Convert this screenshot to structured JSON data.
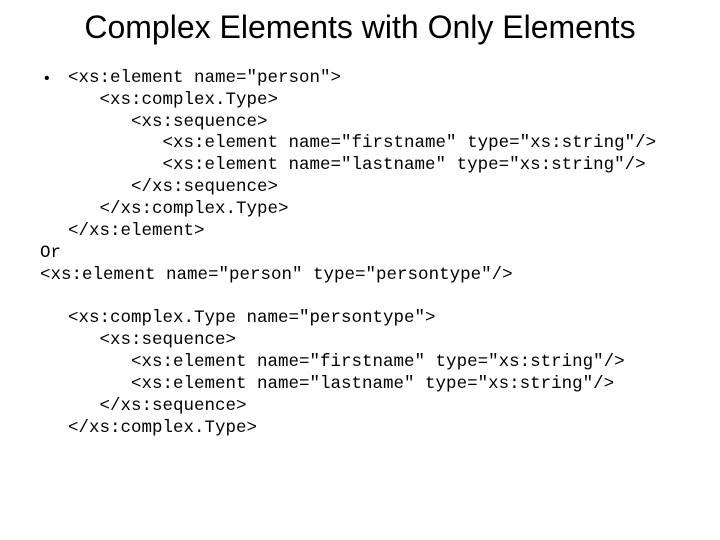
{
  "slide": {
    "title": "Complex Elements with Only Elements",
    "bullet": "•",
    "code1": "<xs:element name=\"person\">\n   <xs:complex.Type>\n      <xs:sequence>\n         <xs:element name=\"firstname\" type=\"xs:string\"/>\n         <xs:element name=\"lastname\" type=\"xs:string\"/>\n      </xs:sequence>\n   </xs:complex.Type>\n</xs:element>",
    "or": "Or",
    "code2": "<xs:element name=\"person\" type=\"persontype\"/>",
    "code3": "<xs:complex.Type name=\"persontype\">\n   <xs:sequence>\n      <xs:element name=\"firstname\" type=\"xs:string\"/>\n      <xs:element name=\"lastname\" type=\"xs:string\"/>\n   </xs:sequence>\n</xs:complex.Type>"
  }
}
